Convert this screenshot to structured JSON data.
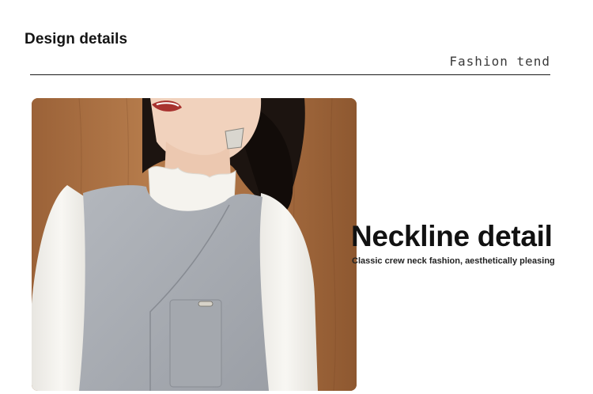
{
  "section": {
    "title": "Design details",
    "subtitle": "Fashion tend"
  },
  "photo": {
    "description_icon": "model-photo",
    "colors": {
      "wood": "#a86f42",
      "vest": "#a9adb3",
      "blouse": "#f3f1ec",
      "hair": "#1c1410",
      "skin": "#f1d2bd"
    }
  },
  "feature": {
    "heading": "Neckline detail",
    "caption": "Classic crew neck fashion, aesthetically pleasing"
  }
}
